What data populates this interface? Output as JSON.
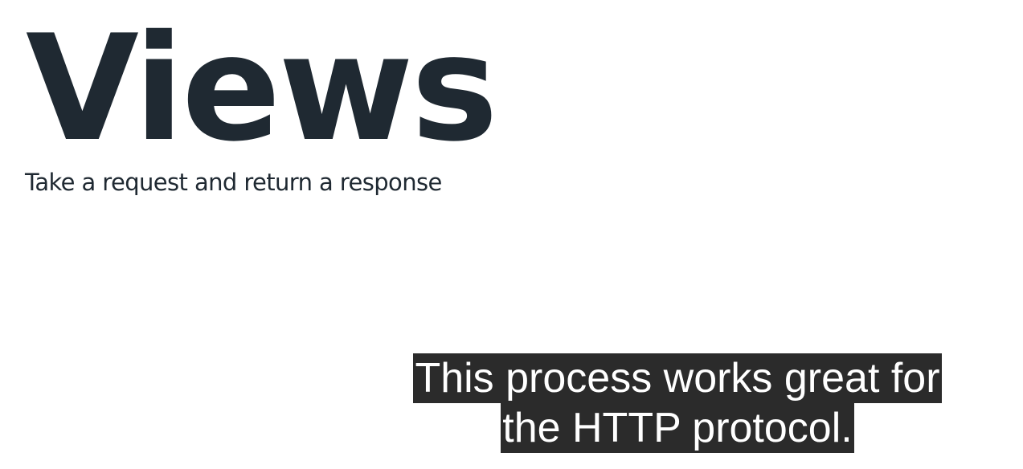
{
  "slide": {
    "title": "Views",
    "subtitle": "Take a request and return a response"
  },
  "caption": {
    "lines": [
      "This process works great for",
      "the HTTP protocol."
    ],
    "background_color": "#2b2b2b",
    "text_color": "#ffffff"
  },
  "colors": {
    "slide_background": "#ffffff",
    "title_text": "#1f2932"
  }
}
